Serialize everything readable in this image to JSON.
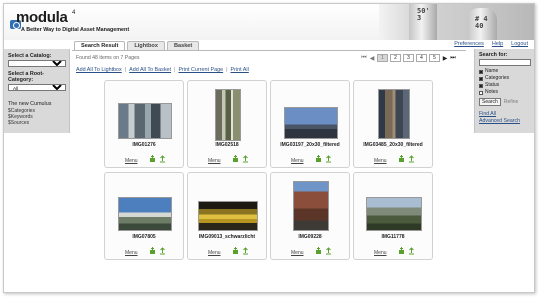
{
  "header": {
    "logo_text": "modula",
    "logo_sup": "4",
    "tagline": "A Better Way to Digital Asset Management",
    "photo_text_1": "50'\n3",
    "photo_text_2": "# 4\n40"
  },
  "toplinks": [
    "Preferences",
    "Help",
    "Logout"
  ],
  "tabs": [
    {
      "label": "Search Result",
      "active": true
    },
    {
      "label": "Lightbox",
      "active": false
    },
    {
      "label": "Basket",
      "active": false
    }
  ],
  "left": {
    "catalog_label": "Select a Catalog:",
    "catalog_value": "",
    "root_label": "Select a Root-Category:",
    "root_value": "All",
    "cumulus_title": "The new Cumulus",
    "cumulus_items": [
      "$Categories",
      "$Keywords",
      "$Sources"
    ]
  },
  "right": {
    "search_label": "Search for:",
    "search_value": "",
    "checks": [
      {
        "label": "Name",
        "checked": true
      },
      {
        "label": "Categories",
        "checked": true
      },
      {
        "label": "Status",
        "checked": true
      },
      {
        "label": "Notes",
        "checked": false
      }
    ],
    "search_button": "Search",
    "refine_label": "Refine",
    "find_all": "Find All",
    "advanced_search": "Advanced Search"
  },
  "found_text": "Found 48 items on 7 Pages",
  "pager": {
    "pages": [
      "1",
      "2",
      "3",
      "4",
      "5"
    ],
    "current": "1"
  },
  "actions": [
    "Add All To Lightbox",
    "Add All To Basket",
    "Print Current Page",
    "Print All"
  ],
  "menu_label": "Menu",
  "items": [
    {
      "caption": "IMG01276"
    },
    {
      "caption": "IMG02518"
    },
    {
      "caption": "IMG03197_20x30_filtered"
    },
    {
      "caption": "IMG03485_20x30_filtered"
    },
    {
      "caption": "IMG07805"
    },
    {
      "caption": "IMG09013_schwarzlicht"
    },
    {
      "caption": "IMG09228"
    },
    {
      "caption": "IMG11778"
    }
  ],
  "colors": {
    "accent_link": "#2a4f86",
    "sidebar_bg": "#d9d9d9",
    "icon_green": "#5aa02c"
  }
}
